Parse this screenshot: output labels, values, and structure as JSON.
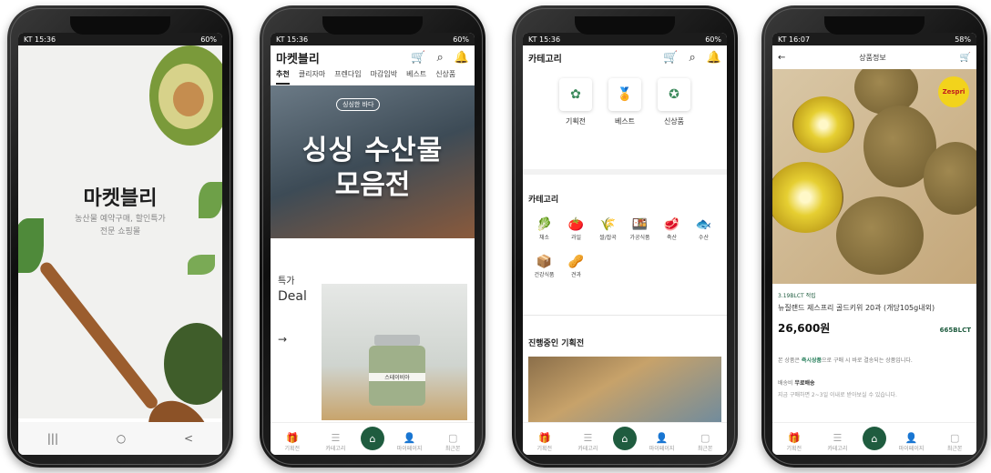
{
  "phones": [
    {
      "status": {
        "left": "KT 15:36",
        "right": "60%"
      },
      "splash": {
        "logo": "마켓블리",
        "sub1": "농산물 예약구매, 할인특가",
        "sub2": "전문 쇼핑몰"
      },
      "nav": {
        "recent": "|||",
        "home": "○",
        "back": "<"
      }
    },
    {
      "status": {
        "left": "KT 15:36",
        "right": "60%"
      },
      "header": {
        "title": "마켓블리",
        "icons": [
          "cart-icon",
          "search-icon",
          "bell-icon"
        ]
      },
      "tabs": [
        "추천",
        "클리자마",
        "프렌다임",
        "마감임박",
        "베스트",
        "신상품"
      ],
      "banner": {
        "tag": "싱싱한 바다",
        "line1": "싱싱 수산물",
        "line2": "모음전"
      },
      "deal": {
        "label": "특가",
        "big": "Deal",
        "arrow": "→"
      },
      "jar_label": "스테이비아"
    },
    {
      "status": {
        "left": "KT 15:36",
        "right": "60%"
      },
      "header": {
        "title": "카테고리"
      },
      "top_tiles": [
        {
          "label": "기획전"
        },
        {
          "label": "베스트"
        },
        {
          "label": "신상품"
        }
      ],
      "category_title": "카테고리",
      "categories": [
        {
          "label": "채소",
          "icon": "🥬"
        },
        {
          "label": "과일",
          "icon": "🍅"
        },
        {
          "label": "쌀/잡곡",
          "icon": "🌾"
        },
        {
          "label": "가공식품",
          "icon": "🍱"
        },
        {
          "label": "축산",
          "icon": "🥩"
        },
        {
          "label": "수산",
          "icon": "🐟"
        },
        {
          "label": "건강식품",
          "icon": "📦"
        },
        {
          "label": "견과",
          "icon": "🥜"
        }
      ],
      "promo_title": "진행중인 기획전"
    },
    {
      "status": {
        "left": "KT 16:07",
        "right": "58%"
      },
      "header": {
        "title": "상품정보"
      },
      "badge": "3.19BLCT 적립",
      "name": "뉴질랜드 제스프리 골드키위 20과 (개당105g내외)",
      "price": "26,600원",
      "blct": "665BLCT",
      "note_pre": "본 상품은 ",
      "note_bold": "즉시상품",
      "note_post": "으로 구매 시 바로 결송되는 상품입니다.",
      "ship_label": "배송비 ",
      "ship_value": "무료배송",
      "ship_detail": "지금 구매하면 2~3일 이내로 받아보실 수 있습니다.",
      "logo_text": "Zespri"
    }
  ],
  "bottom_nav": [
    {
      "label": "기획전",
      "icon": "gift-icon"
    },
    {
      "label": "카테고리",
      "icon": "menu-icon"
    },
    {
      "label": "",
      "icon": "home-icon"
    },
    {
      "label": "마이페이지",
      "icon": "user-icon"
    },
    {
      "label": "최근본",
      "icon": "recent-icon"
    }
  ],
  "colors": {
    "brand": "#1f5c3f",
    "accent": "#3c8a5c"
  }
}
